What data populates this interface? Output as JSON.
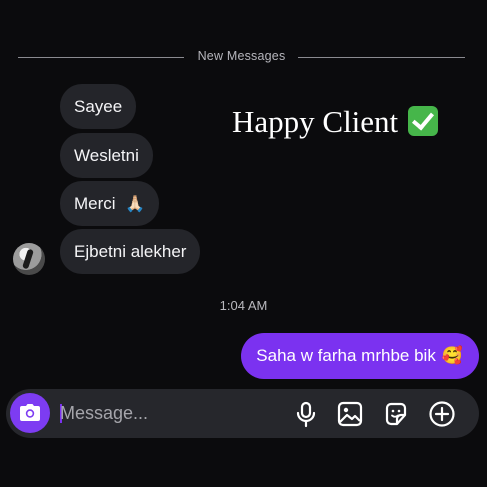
{
  "divider": {
    "label": "New Messages"
  },
  "received": [
    {
      "text": "Sayee",
      "emoji": ""
    },
    {
      "text": "Wesletni",
      "emoji": ""
    },
    {
      "text": "Merci",
      "emoji": "🙏🏻"
    },
    {
      "text": "Ejbetni alekher",
      "emoji": ""
    }
  ],
  "overlay": {
    "text": "Happy Client"
  },
  "timestamp": "1:04 AM",
  "sent": {
    "text": "Saha w farha mrhbe bik",
    "emoji": "🥰"
  },
  "composer": {
    "placeholder": "Message..."
  },
  "icons": {
    "camera": "camera-icon",
    "mic": "microphone-icon",
    "gallery": "image-icon",
    "sticker": "sticker-icon",
    "add": "plus-circle-icon",
    "check": "check-mark-icon"
  },
  "colors": {
    "accent": "#7b32f0",
    "received_bubble": "#24252a",
    "background": "#0b0b0d",
    "check_green": "#46b64a"
  }
}
